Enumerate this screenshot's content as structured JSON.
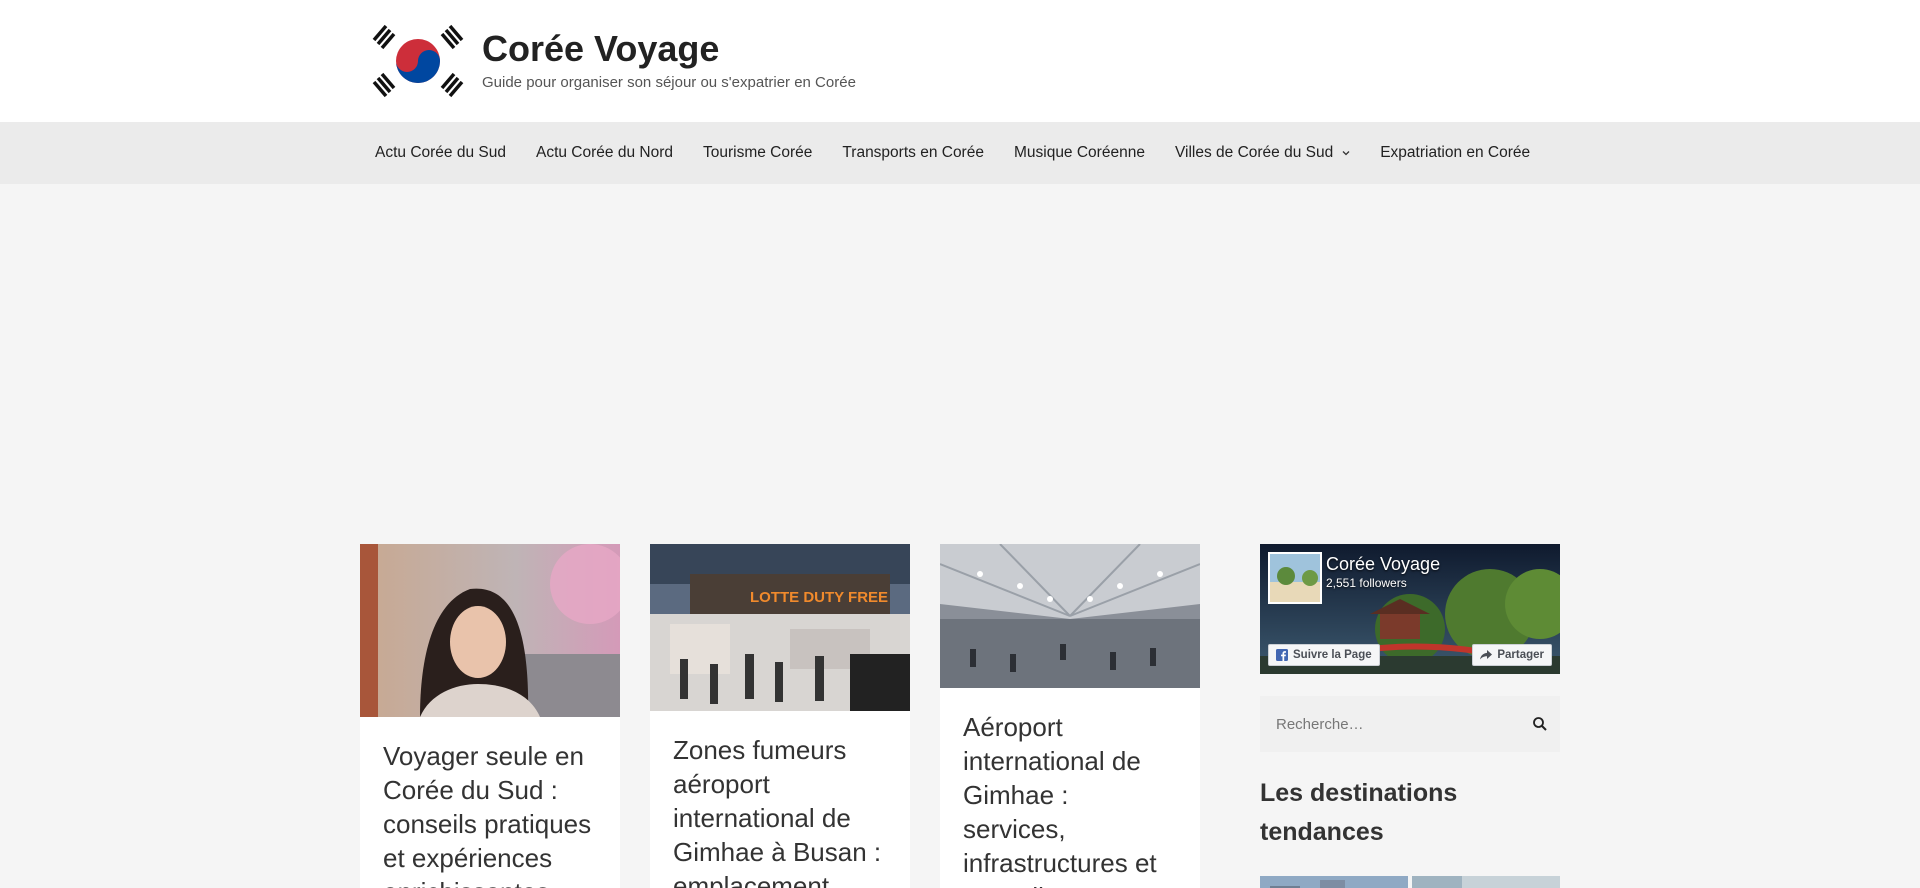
{
  "header": {
    "logo_icon": "korean-flag-icon",
    "title": "Corée Voyage",
    "tagline": "Guide pour organiser son séjour ou s'expatrier en Corée"
  },
  "nav": {
    "items": [
      {
        "label": "Actu Corée du Sud"
      },
      {
        "label": "Actu Corée du Nord"
      },
      {
        "label": "Tourisme Corée"
      },
      {
        "label": "Transports en Corée"
      },
      {
        "label": "Musique Coréenne"
      },
      {
        "label": "Villes de Corée du Sud",
        "icon": "chevron-down-icon"
      },
      {
        "label": "Expatriation en Corée"
      }
    ]
  },
  "posts": [
    {
      "title": "Voyager seule en Corée du Sud : conseils pratiques et expériences enrichissantes"
    },
    {
      "title": "Zones fumeurs aéroport international de Gimhae à Busan : emplacement"
    },
    {
      "title": "Aéroport international de Gimhae : services, infrastructures et conseils"
    }
  ],
  "sidebar": {
    "facebook": {
      "page_name": "Corée Voyage",
      "followers": "2,551 followers",
      "follow_label": "Suivre la Page",
      "share_label": "Partager"
    },
    "search": {
      "placeholder": "Recherche…"
    },
    "widget_title": "Les destinations tendances"
  },
  "colors": {
    "header_bg": "#ffffff",
    "nav_bg": "#ebebeb",
    "page_bg": "#f5f5f5",
    "flag_red": "#cd2e3a",
    "flag_blue": "#0047a0"
  }
}
